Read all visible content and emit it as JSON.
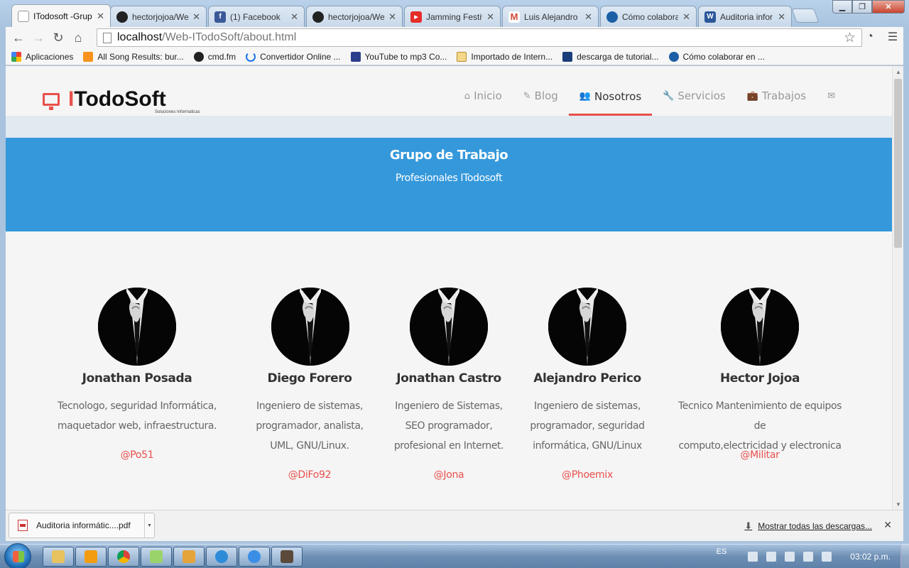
{
  "browser": {
    "tabs": [
      {
        "title": "ITodosoft -Grup",
        "favicon": "page-icon",
        "color": "#ffffff",
        "active": true
      },
      {
        "title": "hectorjojoa/We",
        "favicon": "github-icon",
        "color": "#222222"
      },
      {
        "title": "(1) Facebook",
        "favicon": "facebook-icon",
        "color": "#3b5998"
      },
      {
        "title": "hectorjojoa/We",
        "favicon": "github-icon",
        "color": "#222222"
      },
      {
        "title": "Jamming Festiv",
        "favicon": "youtube-icon",
        "color": "#e52d27"
      },
      {
        "title": "Luis Alejandro P",
        "favicon": "gmail-icon",
        "color": "#d14836"
      },
      {
        "title": "Cómo colabora",
        "favicon": "site-icon",
        "color": "#1d5fa6"
      },
      {
        "title": "Auditoria infor",
        "favicon": "word-icon",
        "color": "#2b579a"
      }
    ],
    "url_host": "localhost",
    "url_path": "/Web-ITodoSoft/about.html",
    "bookmarks": [
      {
        "label": "Aplicaciones",
        "icon": "apps-grid-icon",
        "color": "#e94235"
      },
      {
        "label": "All Song Results: bur...",
        "icon": "orange-icon",
        "color": "#f7931e"
      },
      {
        "label": "cmd.fm",
        "icon": "cmd-icon",
        "color": "#222222"
      },
      {
        "label": "Convertidor Online ...",
        "icon": "refresh-icon",
        "color": "#1a73e8"
      },
      {
        "label": "YouTube to mp3 Co...",
        "icon": "mp3-icon",
        "color": "#2c3e8c"
      },
      {
        "label": "Importado de Intern...",
        "icon": "folder-icon",
        "color": "#e8c25e"
      },
      {
        "label": "descarga de tutorial...",
        "icon": "download-icon",
        "color": "#1b3e7a"
      },
      {
        "label": "Cómo colaborar en ...",
        "icon": "site-icon",
        "color": "#1d5fa6"
      }
    ]
  },
  "site": {
    "brand_first": "I",
    "brand_rest": "TodoSoft",
    "brand_sub": "Soluciones Informaticas",
    "accent_color": "#e8504c",
    "nav": [
      {
        "label": "Inicio",
        "icon": "home-icon",
        "active": false
      },
      {
        "label": "Blog",
        "icon": "pencil-icon",
        "active": false
      },
      {
        "label": "Nosotros",
        "icon": "users-icon",
        "active": true
      },
      {
        "label": "Servicios",
        "icon": "wrench-icon",
        "active": false
      },
      {
        "label": "Trabajos",
        "icon": "briefcase-icon",
        "active": false
      },
      {
        "label": "",
        "icon": "envelope-icon",
        "active": false
      }
    ],
    "hero": {
      "title": "Grupo de Trabajo",
      "subtitle": "Profesionales ITodosoft",
      "color": "#3498db"
    },
    "team": [
      {
        "name": "Jonathan Posada",
        "desc": [
          "Tecnologo, seguridad Informática,",
          "maquetador web, infraestructura."
        ],
        "handle": "@Po51"
      },
      {
        "name": "Diego Forero",
        "desc": [
          "Ingeniero de sistemas,",
          "programador, analista,",
          "UML, GNU/Linux."
        ],
        "handle": "@DiFo92"
      },
      {
        "name": "Jonathan Castro",
        "desc": [
          "Ingeniero de Sistemas,",
          "SEO programador,",
          "profesional en Internet."
        ],
        "handle": "@Jona"
      },
      {
        "name": "Alejandro Perico",
        "desc": [
          "Ingeniero de sistemas,",
          "programador, seguridad",
          "informática, GNU/Linux"
        ],
        "handle": "@Phoemix"
      },
      {
        "name": "Hector Jojoa",
        "desc": [
          "Tecnico Mantenimiento de equipos de",
          "computo,electricidad y electronica"
        ],
        "handle": "@Militar"
      }
    ]
  },
  "downloads": {
    "file": "Auditoria informátic....pdf",
    "show_all": "Mostrar todas las descargas..."
  },
  "taskbar": {
    "lang": "ES",
    "time": "03:02 p.m."
  }
}
